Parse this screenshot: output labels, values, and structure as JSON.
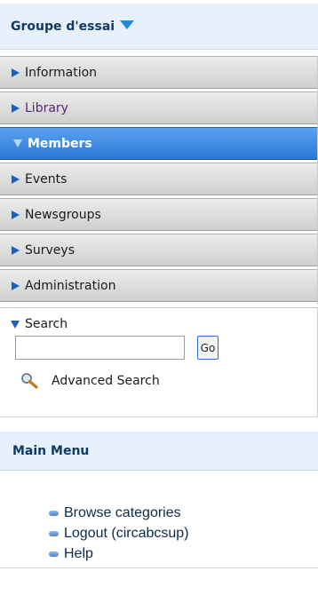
{
  "group": {
    "title": "Groupe d'essai"
  },
  "nav": {
    "items": [
      {
        "label": "Information",
        "state": "normal"
      },
      {
        "label": "Library",
        "state": "visited"
      },
      {
        "label": "Members",
        "state": "active"
      },
      {
        "label": "Events",
        "state": "normal"
      },
      {
        "label": "Newsgroups",
        "state": "normal"
      },
      {
        "label": "Surveys",
        "state": "normal"
      },
      {
        "label": "Administration",
        "state": "normal"
      }
    ]
  },
  "search": {
    "heading": "Search",
    "placeholder": "",
    "value": "",
    "go_label": "Go",
    "advanced_label": "Advanced Search"
  },
  "main_menu": {
    "title": "Main Menu",
    "items": [
      {
        "label": "Browse categories"
      },
      {
        "label": "Logout (circabcsup)"
      },
      {
        "label": "Help"
      }
    ]
  },
  "colors": {
    "accent": "#2c78d6",
    "header_bg": "#e6f1fb",
    "header_text": "#0e3a64"
  }
}
